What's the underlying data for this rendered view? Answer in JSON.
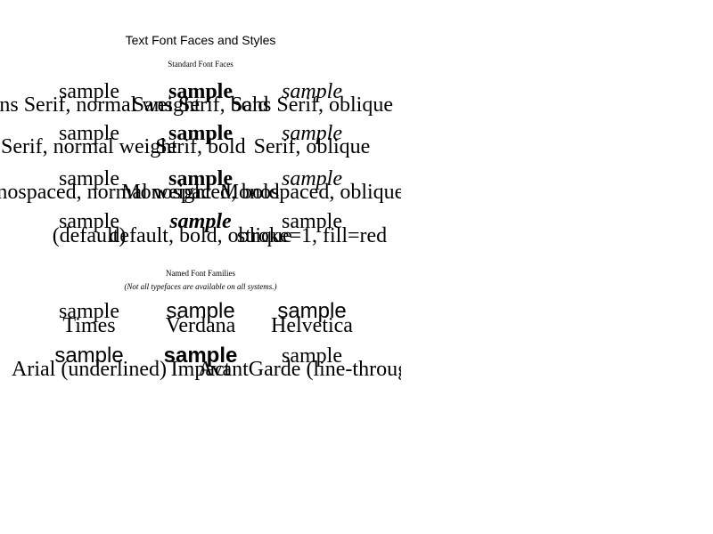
{
  "title": "Text Font Faces and Styles",
  "section_standard": {
    "heading": "Standard Font Faces",
    "sample": "sample",
    "rows": [
      [
        "Sans Serif, normal weight",
        "Sans Serif, bold",
        "Sans Serif, oblique"
      ],
      [
        "Serif, normal weight",
        "Serif, bold",
        "Serif, oblique"
      ],
      [
        "Monospaced, normal weight",
        "Monospaced, bold",
        "Monospaced, oblique"
      ],
      [
        "(default)",
        "default, bold, oblique",
        "stroke=1, fill=red"
      ]
    ]
  },
  "section_named": {
    "heading": "Named Font Families",
    "note": "(Not all typefaces are available on all systems.)",
    "sample": "sample",
    "rows": [
      [
        "Times",
        "Verdana",
        "Helvetica"
      ],
      [
        "Arial (underlined)",
        "Impact",
        "AvantGarde (line-through)"
      ]
    ]
  }
}
